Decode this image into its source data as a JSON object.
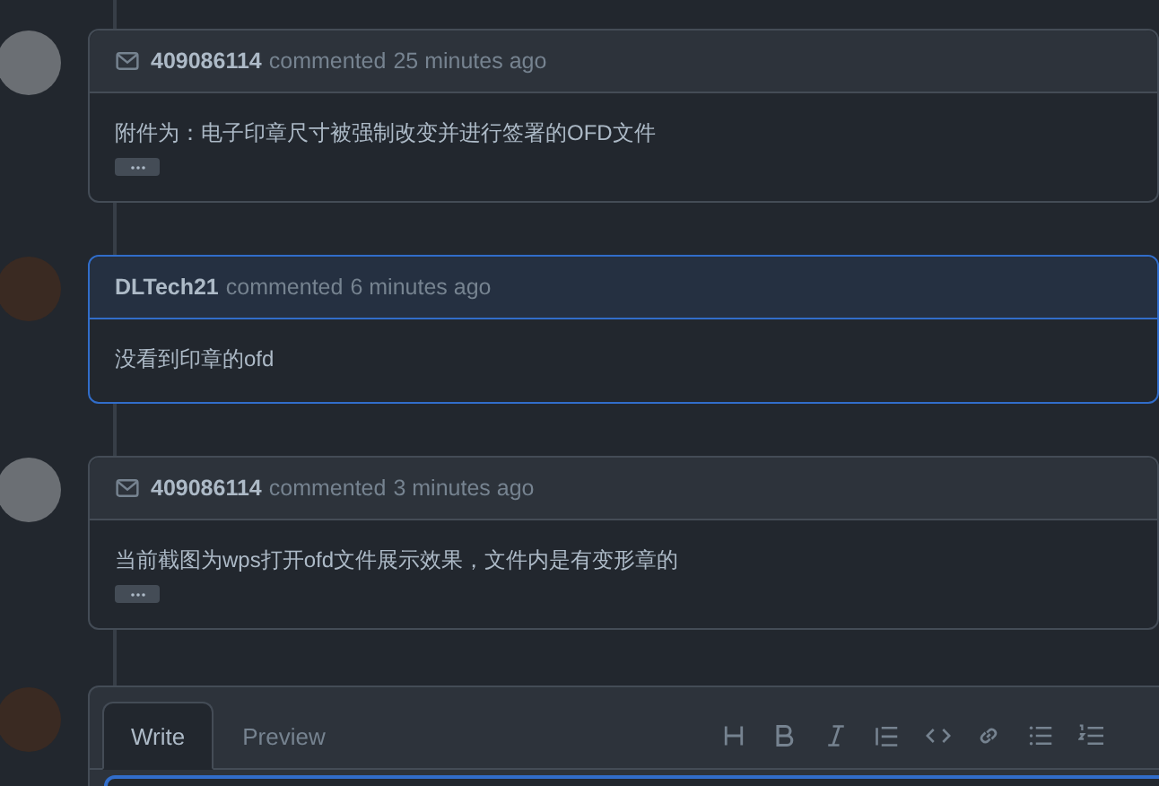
{
  "comments": [
    {
      "author": "409086114",
      "action": "commented",
      "time": "25 minutes ago",
      "via_email": true,
      "highlighted": false,
      "body": "附件为：电子印章尺寸被强制改变并进行签署的OFD文件",
      "has_more": true
    },
    {
      "author": "DLTech21",
      "action": "commented",
      "time": "6 minutes ago",
      "via_email": false,
      "highlighted": true,
      "body": "没看到印章的ofd",
      "has_more": false
    },
    {
      "author": "409086114",
      "action": "commented",
      "time": "3 minutes ago",
      "via_email": true,
      "highlighted": false,
      "body": "当前截图为wps打开ofd文件展示效果，文件内是有变形章的",
      "has_more": true
    }
  ],
  "composer": {
    "tabs": [
      {
        "label": "Write",
        "selected": true
      },
      {
        "label": "Preview",
        "selected": false
      }
    ],
    "toolbar": [
      {
        "kind": "heading"
      },
      {
        "kind": "bold"
      },
      {
        "kind": "italic"
      },
      {
        "kind": "quote"
      },
      {
        "kind": "code"
      },
      {
        "kind": "link"
      },
      {
        "kind": "bullet-list"
      },
      {
        "kind": "numbered-list"
      }
    ]
  }
}
